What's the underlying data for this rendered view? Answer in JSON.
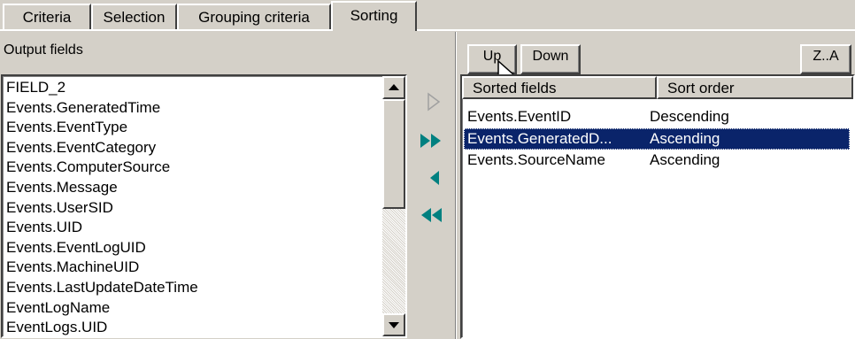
{
  "tabs": [
    {
      "label": "Criteria",
      "active": false
    },
    {
      "label": "Selection",
      "active": false
    },
    {
      "label": "Grouping criteria",
      "active": false
    },
    {
      "label": "Sorting",
      "active": true
    }
  ],
  "output_fields": {
    "label": "Output fields",
    "items": [
      "FIELD_2",
      "Events.GeneratedTime",
      "Events.EventType",
      "Events.EventCategory",
      "Events.ComputerSource",
      "Events.Message",
      "Events.UserSID",
      "Events.UID",
      "Events.EventLogUID",
      "Events.MachineUID",
      "Events.LastUpdateDateTime",
      "EventLogName",
      "EventLogs.UID"
    ]
  },
  "toolbar": {
    "up_label": "Up",
    "down_label": "Down",
    "za_label": "Z..A"
  },
  "transfer_buttons": {
    "add_one_icon": "triangle-right-outline-icon",
    "add_all_icon": "double-triangle-right-icon",
    "remove_one_icon": "triangle-left-icon",
    "remove_all_icon": "double-triangle-left-icon",
    "add_one_enabled": false,
    "accent_color": "#008080",
    "disabled_color": "#a0a0a0"
  },
  "sorted": {
    "columns": [
      "Sorted fields",
      "Sort order"
    ],
    "rows": [
      {
        "field": "Events.EventID",
        "order": "Descending",
        "selected": false
      },
      {
        "field": "Events.GeneratedD...",
        "order": "Ascending",
        "selected": true
      },
      {
        "field": "Events.SourceName",
        "order": "Ascending",
        "selected": false
      }
    ]
  },
  "colors": {
    "face": "#d4d0c8",
    "selection": "#0a246a",
    "list_bg": "#ffffff"
  }
}
